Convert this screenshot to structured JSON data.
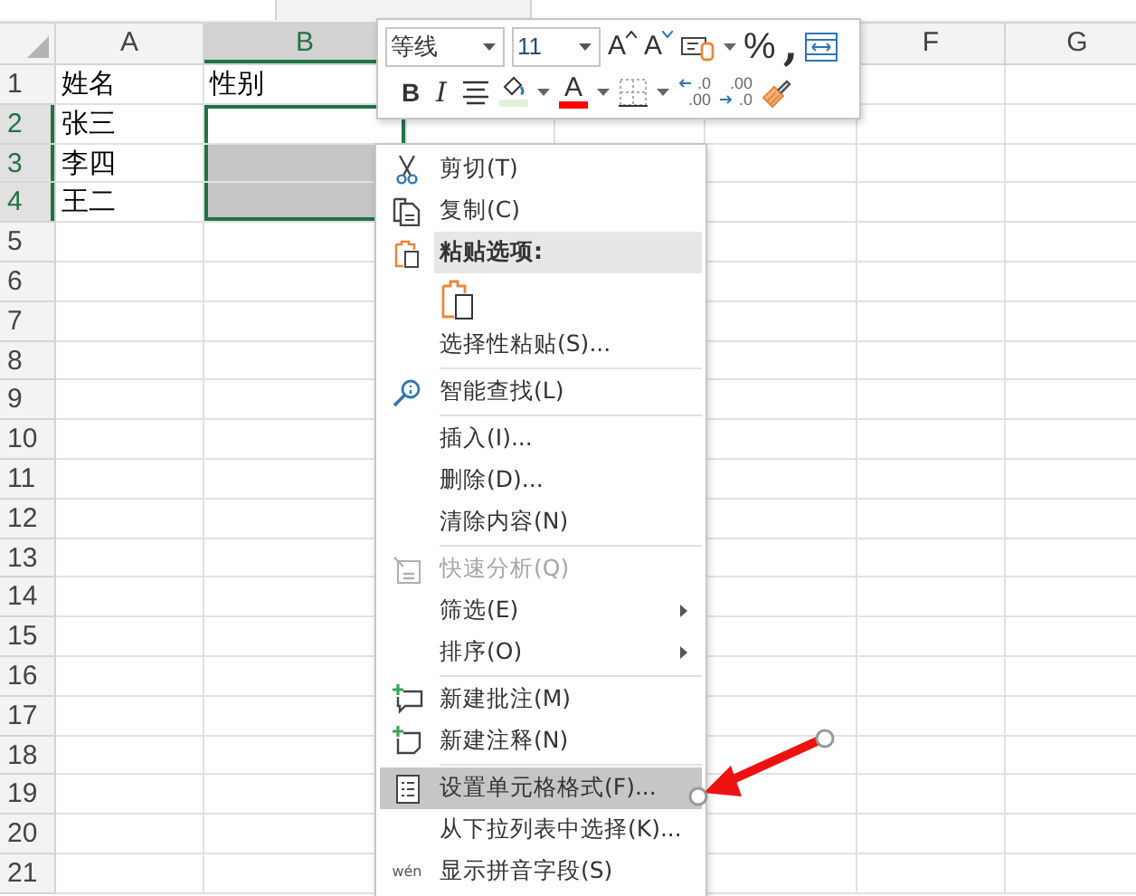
{
  "columns": [
    {
      "label": "A",
      "selected": false
    },
    {
      "label": "B",
      "selected": true
    },
    {
      "label": "F",
      "selected": false
    },
    {
      "label": "G",
      "selected": false
    }
  ],
  "rows": [
    {
      "label": "1",
      "selected": false,
      "cells": [
        {
          "text": "姓名",
          "selected": false
        },
        {
          "text": "性别",
          "selected": false
        }
      ]
    },
    {
      "label": "2",
      "selected": true,
      "cells": [
        {
          "text": "张三",
          "selected": false
        },
        {
          "selected": true,
          "active": true
        }
      ]
    },
    {
      "label": "3",
      "selected": true,
      "cells": [
        {
          "text": "李四",
          "selected": false
        },
        {
          "selected": true,
          "active": false
        }
      ]
    },
    {
      "label": "4",
      "selected": true,
      "cells": [
        {
          "text": "王二",
          "selected": false
        },
        {
          "selected": true,
          "active": false
        }
      ]
    },
    {
      "label": "5",
      "selected": false
    },
    {
      "label": "6",
      "selected": false
    },
    {
      "label": "7",
      "selected": false
    },
    {
      "label": "8",
      "selected": false
    },
    {
      "label": "9",
      "selected": false
    },
    {
      "label": "10",
      "selected": false
    },
    {
      "label": "11",
      "selected": false
    },
    {
      "label": "12",
      "selected": false
    },
    {
      "label": "13",
      "selected": false
    },
    {
      "label": "14",
      "selected": false
    },
    {
      "label": "15",
      "selected": false
    },
    {
      "label": "16",
      "selected": false
    },
    {
      "label": "17",
      "selected": false
    },
    {
      "label": "18",
      "selected": false
    },
    {
      "label": "19",
      "selected": false
    },
    {
      "label": "20",
      "selected": false
    },
    {
      "label": "21",
      "selected": false
    }
  ],
  "toolbar": {
    "font": {
      "value": "等线"
    },
    "size": {
      "value": "11"
    },
    "row1": [
      {
        "kind": "grow",
        "label": "A"
      },
      {
        "kind": "shrink",
        "label": "A"
      },
      {
        "kind": "accounting"
      },
      {
        "kind": "caret"
      },
      {
        "kind": "text",
        "label": "%"
      },
      {
        "kind": "comma",
        "label": ","
      },
      {
        "kind": "wrap"
      }
    ],
    "row2": [
      {
        "kind": "bold",
        "label": "B"
      },
      {
        "kind": "italic",
        "label": "I"
      },
      {
        "kind": "align"
      },
      {
        "kind": "fill"
      },
      {
        "kind": "caret"
      },
      {
        "kind": "font-color",
        "label": "A"
      },
      {
        "kind": "caret"
      },
      {
        "kind": "borders"
      },
      {
        "kind": "caret"
      },
      {
        "kind": "increase-decimal",
        "lines": [
          ".0",
          ".00"
        ]
      },
      {
        "kind": "decrease-decimal",
        "lines": [
          ".00",
          ".0"
        ]
      },
      {
        "kind": "painter"
      }
    ]
  },
  "menu": [
    {
      "kind": "command",
      "label": "剪切(T)",
      "selected": false,
      "disabled": false,
      "submenu": false
    },
    {
      "kind": "command",
      "label": "复制(C)",
      "selected": false,
      "disabled": false,
      "submenu": false
    },
    {
      "kind": "header",
      "label": "粘贴选项:"
    },
    {
      "kind": "paste-options"
    },
    {
      "kind": "command",
      "label": "选择性粘贴(S)...",
      "selected": false,
      "disabled": false,
      "submenu": false
    },
    {
      "kind": "separator"
    },
    {
      "kind": "command",
      "label": "智能查找(L)",
      "selected": false,
      "disabled": false,
      "submenu": false
    },
    {
      "kind": "separator"
    },
    {
      "kind": "command",
      "label": "插入(I)...",
      "selected": false,
      "disabled": false,
      "submenu": false
    },
    {
      "kind": "command",
      "label": "删除(D)...",
      "selected": false,
      "disabled": false,
      "submenu": false
    },
    {
      "kind": "command",
      "label": "清除内容(N)",
      "selected": false,
      "disabled": false,
      "submenu": false
    },
    {
      "kind": "separator"
    },
    {
      "kind": "command",
      "label": "快速分析(Q)",
      "selected": false,
      "disabled": true,
      "submenu": false
    },
    {
      "kind": "command",
      "label": "筛选(E)",
      "selected": false,
      "disabled": false,
      "submenu": true
    },
    {
      "kind": "command",
      "label": "排序(O)",
      "selected": false,
      "disabled": false,
      "submenu": true
    },
    {
      "kind": "separator"
    },
    {
      "kind": "command",
      "label": "新建批注(M)",
      "selected": false,
      "disabled": false,
      "submenu": false
    },
    {
      "kind": "command",
      "label": "新建注释(N)",
      "selected": false,
      "disabled": false,
      "submenu": false
    },
    {
      "kind": "separator"
    },
    {
      "kind": "command",
      "label": "设置单元格格式(F)...",
      "selected": true,
      "disabled": false,
      "submenu": false
    },
    {
      "kind": "command",
      "label": "从下拉列表中选择(K)...",
      "selected": false,
      "disabled": false,
      "submenu": false
    },
    {
      "kind": "command",
      "label": "显示拼音字段(S)",
      "selected": false,
      "disabled": false,
      "submenu": false,
      "icon_text": "wén"
    }
  ]
}
